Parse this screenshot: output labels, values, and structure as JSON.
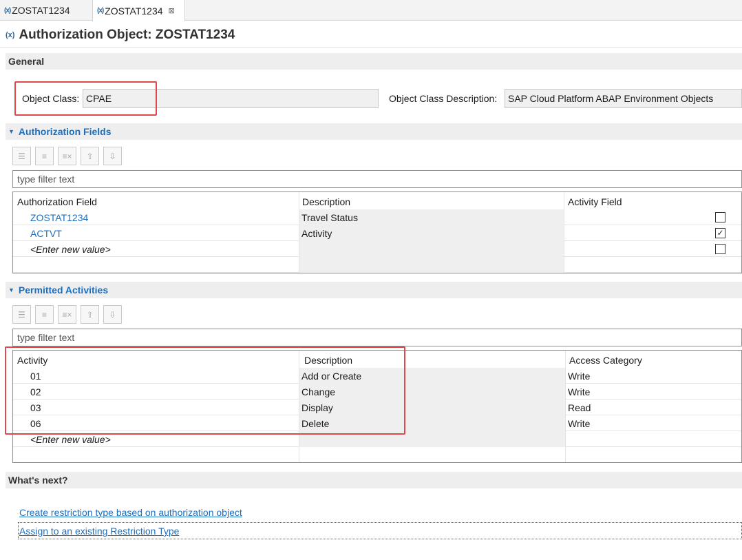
{
  "tabs": [
    {
      "icon": "(x)",
      "label": "ZOSTAT1234"
    },
    {
      "icon": "(x)",
      "label": "ZOSTAT1234",
      "close": "⊠"
    }
  ],
  "header": {
    "icon": "(x)",
    "title": "Authorization Object: ZOSTAT1234"
  },
  "general": {
    "title": "General",
    "object_class_label": "Object Class:",
    "object_class_value": "CPAE",
    "object_class_desc_label": "Object Class Description:",
    "object_class_desc_value": "SAP Cloud Platform ABAP Environment Objects"
  },
  "auth_fields": {
    "title": "Authorization Fields",
    "filter_placeholder": "type filter text",
    "columns": [
      "Authorization Field",
      "Description",
      "Activity Field"
    ],
    "rows": [
      {
        "field": "ZOSTAT1234",
        "description": "Travel Status",
        "activity_field": false
      },
      {
        "field": "ACTVT",
        "description": "Activity",
        "activity_field": true
      },
      {
        "field": "<Enter new value>",
        "description": "",
        "activity_field": false
      }
    ]
  },
  "permitted": {
    "title": "Permitted Activities",
    "filter_placeholder": "type filter text",
    "columns": [
      "Activity",
      "Description",
      "Access Category"
    ],
    "rows": [
      {
        "activity": "01",
        "description": "Add or Create",
        "access": "Write"
      },
      {
        "activity": "02",
        "description": "Change",
        "access": "Write"
      },
      {
        "activity": "03",
        "description": "Display",
        "access": "Read"
      },
      {
        "activity": "06",
        "description": "Delete",
        "access": "Write"
      },
      {
        "activity": "<Enter new value>",
        "description": "",
        "access": ""
      }
    ]
  },
  "whats_next": {
    "title": "What's next?",
    "links": [
      "Create restriction type based on authorization object",
      "Assign to an existing Restriction Type"
    ]
  },
  "toolbar_icons": [
    "add-icon",
    "insert-icon",
    "delete-icon",
    "move-up-icon",
    "move-down-icon"
  ],
  "colors": {
    "link": "#1a6fc0",
    "highlight": "#e0484b",
    "section_bg": "#eeeeee"
  }
}
